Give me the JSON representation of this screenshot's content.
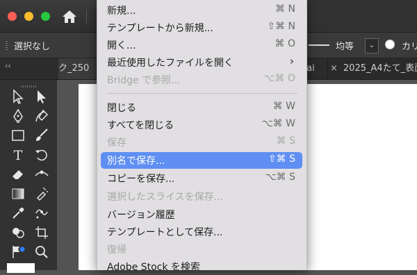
{
  "window": {
    "traffic_lights": {
      "close": "#fe5f57",
      "minimize": "#febc2e",
      "maximize": "#28c840"
    },
    "home_icon": "home-icon"
  },
  "control_bar": {
    "selection_label": "選択なし",
    "stroke_profile_label": "均等",
    "dropdown_glyph": "⌄",
    "style_label": "カリ"
  },
  "tabs": {
    "tab1": "ク_250",
    "tab2": ".ai",
    "tab3_close": "×",
    "tab3": "2025_A4たて_表面"
  },
  "toolbox": {
    "collapse_glyph": "‹‹",
    "type_tool": "T"
  },
  "file_menu": {
    "items": [
      {
        "label": "新規...",
        "shortcut": "⌘ N",
        "enabled": true
      },
      {
        "label": "テンプレートから新規...",
        "shortcut": "⇧⌘ N",
        "enabled": true
      },
      {
        "label": "開く...",
        "shortcut": "⌘ O",
        "enabled": true
      },
      {
        "label": "最近使用したファイルを開く",
        "shortcut": "›",
        "enabled": true
      },
      {
        "label": "Bridge で参照...",
        "shortcut": "⌥⌘ O",
        "enabled": false
      },
      {
        "label": "閉じる",
        "shortcut": "⌘ W",
        "enabled": true
      },
      {
        "label": "すべてを閉じる",
        "shortcut": "⌥⌘ W",
        "enabled": true
      },
      {
        "label": "保存",
        "shortcut": "⌘ S",
        "enabled": false
      },
      {
        "label": "別名で保存...",
        "shortcut": "⇧⌘ S",
        "enabled": true,
        "highlighted": true
      },
      {
        "label": "コピーを保存...",
        "shortcut": "⌥⌘ S",
        "enabled": true
      },
      {
        "label": "選択したスライスを保存...",
        "shortcut": "",
        "enabled": false
      },
      {
        "label": "バージョン履歴",
        "shortcut": "",
        "enabled": true
      },
      {
        "label": "テンプレートとして保存...",
        "shortcut": "",
        "enabled": true
      },
      {
        "label": "復帰",
        "shortcut": "",
        "enabled": false
      },
      {
        "label": "Adobe Stock を検索",
        "shortcut": "",
        "enabled": true
      }
    ]
  },
  "colors": {
    "menu_highlight": "#5f8ff2",
    "menu_background": "#e1dfe2",
    "app_chrome": "#323232"
  }
}
